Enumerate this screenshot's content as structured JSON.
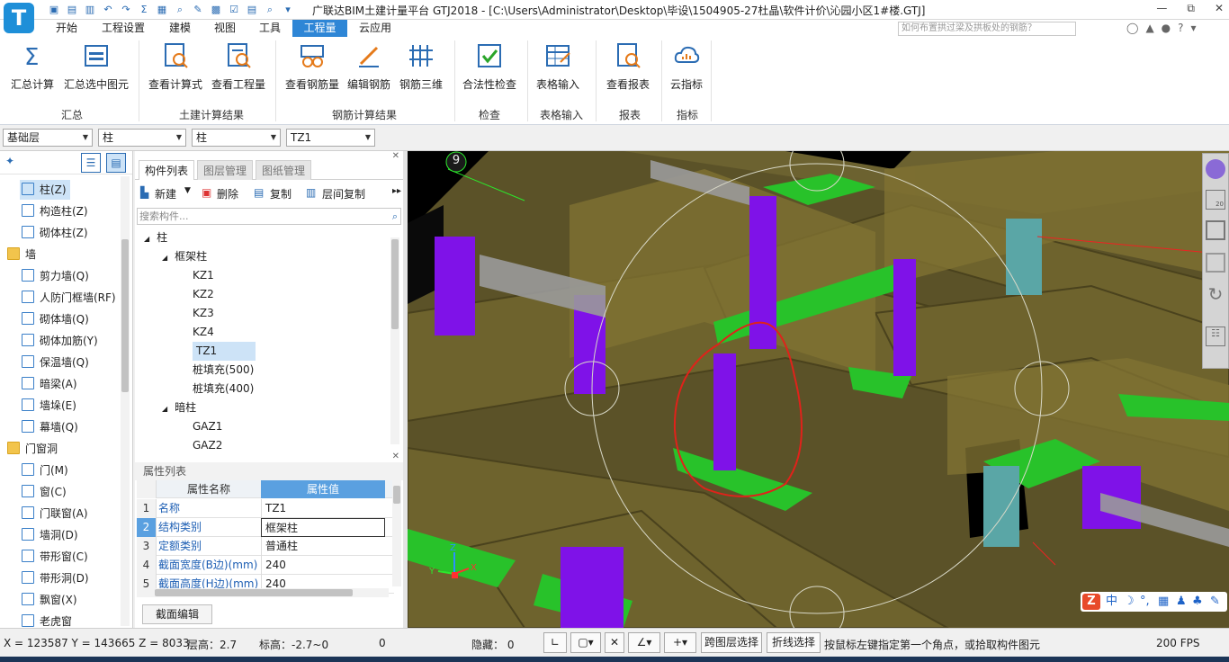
{
  "window": {
    "title": "广联达BIM土建计量平台 GTJ2018 - [C:\\Users\\Administrator\\Desktop\\毕设\\1504905-27杜晶\\软件计价\\沁园小区1#楼.GTJ]",
    "logo_letter": "T",
    "controls": [
      "—",
      "⧉",
      "✕"
    ]
  },
  "menu": {
    "items": [
      "开始",
      "工程设置",
      "建模",
      "视图",
      "工具",
      "工程量",
      "云应用"
    ],
    "active": "工程量",
    "help_search_placeholder": "如何布置拱过梁及拱板处的钢筋？"
  },
  "ribbon": {
    "buttons": [
      "汇总计算",
      "汇总选中图元",
      "查看计算式",
      "查看工程量",
      "查看钢筋量",
      "编辑钢筋",
      "钢筋三维",
      "合法性检查",
      "表格输入",
      "查看报表",
      "云指标"
    ],
    "groups": [
      "汇总",
      "土建计算结果",
      "钢筋计算结果",
      "检查",
      "表格输入",
      "报表",
      "指标"
    ]
  },
  "combos": {
    "floor": "基础层",
    "category": "柱",
    "type": "柱",
    "component": "TZ1"
  },
  "left_nav": {
    "items": [
      {
        "label": "柱(Z)",
        "group": false
      },
      {
        "label": "构造柱(Z)",
        "group": false
      },
      {
        "label": "砌体柱(Z)",
        "group": false
      },
      {
        "label": "墙",
        "group": true
      },
      {
        "label": "剪力墙(Q)",
        "group": false
      },
      {
        "label": "人防门框墙(RF)",
        "group": false
      },
      {
        "label": "砌体墙(Q)",
        "group": false
      },
      {
        "label": "砌体加筋(Y)",
        "group": false
      },
      {
        "label": "保温墙(Q)",
        "group": false
      },
      {
        "label": "暗梁(A)",
        "group": false
      },
      {
        "label": "墙垛(E)",
        "group": false
      },
      {
        "label": "幕墙(Q)",
        "group": false
      },
      {
        "label": "门窗洞",
        "group": true
      },
      {
        "label": "门(M)",
        "group": false
      },
      {
        "label": "窗(C)",
        "group": false
      },
      {
        "label": "门联窗(A)",
        "group": false
      },
      {
        "label": "墙洞(D)",
        "group": false
      },
      {
        "label": "带形窗(C)",
        "group": false
      },
      {
        "label": "带形洞(D)",
        "group": false
      },
      {
        "label": "飘窗(X)",
        "group": false
      },
      {
        "label": "老虎窗",
        "group": false
      }
    ]
  },
  "component_panel": {
    "tabs": [
      "构件列表",
      "图层管理",
      "图纸管理"
    ],
    "toolbar": [
      "新建",
      "删除",
      "复制",
      "层间复制"
    ],
    "search_placeholder": "搜索构件...",
    "tree": [
      {
        "label": "柱",
        "level": 0,
        "expander": "◢"
      },
      {
        "label": "框架柱",
        "level": 1,
        "expander": "◢"
      },
      {
        "label": "KZ1",
        "level": 2
      },
      {
        "label": "KZ2",
        "level": 2
      },
      {
        "label": "KZ3",
        "level": 2
      },
      {
        "label": "KZ4",
        "level": 2
      },
      {
        "label": "TZ1",
        "level": 2,
        "selected": true
      },
      {
        "label": "桩填充(500)",
        "level": 2
      },
      {
        "label": "桩填充(400)",
        "level": 2
      },
      {
        "label": "暗柱",
        "level": 1,
        "expander": "◢"
      },
      {
        "label": "GAZ1",
        "level": 2
      },
      {
        "label": "GAZ2",
        "level": 2
      }
    ]
  },
  "properties": {
    "title": "属性列表",
    "headers": [
      "属性名称",
      "属性值"
    ],
    "rows": [
      {
        "n": "1",
        "key": "名称",
        "value": "TZ1"
      },
      {
        "n": "2",
        "key": "结构类别",
        "value": "框架柱"
      },
      {
        "n": "3",
        "key": "定额类别",
        "value": "普通柱"
      },
      {
        "n": "4",
        "key": "截面宽度(B边)(mm)",
        "value": "240"
      },
      {
        "n": "5",
        "key": "截面高度(H边)(mm)",
        "value": "240"
      }
    ],
    "edit_button": "截面编辑"
  },
  "viewport": {
    "axis_badge": "9",
    "float_toolbar_value": "20",
    "ime_labels": [
      "中"
    ]
  },
  "status": {
    "coords": "X = 123587 Y = 143665 Z = 8033",
    "floor_height": "层高：2.7",
    "elevation": "标高：-2.7~0",
    "count": "0",
    "hidden": "隐藏： 0",
    "cross_layer_select": "跨图层选择",
    "polyline_select": "折线选择",
    "hint": "按鼠标左键指定第一个角点，或拾取构件图元",
    "fps": "200 FPS"
  },
  "colors": {
    "accent": "#2e86d6",
    "concrete": "#6b5f2a",
    "column_purple": "#7f12e8",
    "beam_green": "#28c22a",
    "pile_teal": "#5aa6a6",
    "annotation_red": "#e0221a"
  }
}
